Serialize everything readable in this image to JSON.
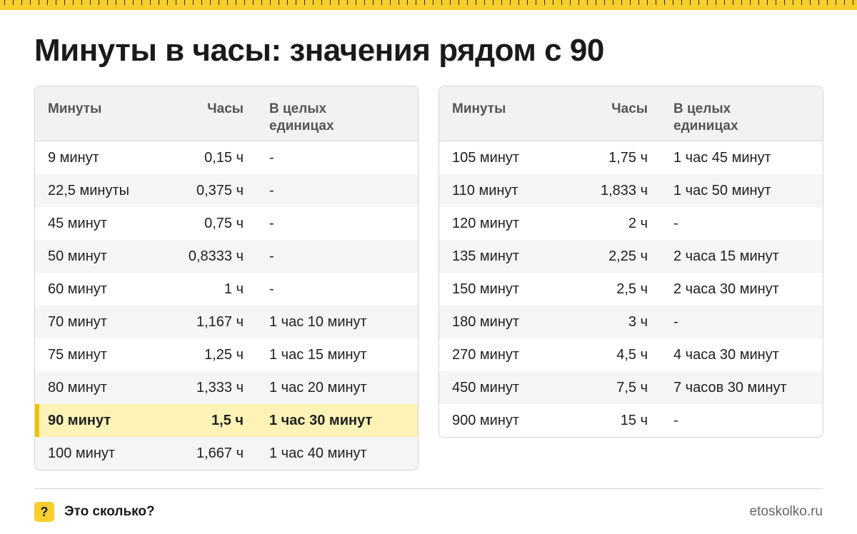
{
  "title": "Минуты в часы: значения рядом с 90",
  "headers": {
    "minutes": "Минуты",
    "hours": "Часы",
    "whole": "В целых\nединицах"
  },
  "left_rows": [
    {
      "minutes": "9 минут",
      "hours": "0,15 ч",
      "whole": "-"
    },
    {
      "minutes": "22,5 минуты",
      "hours": "0,375 ч",
      "whole": "-"
    },
    {
      "minutes": "45 минут",
      "hours": "0,75 ч",
      "whole": "-"
    },
    {
      "minutes": "50 минут",
      "hours": "0,8333 ч",
      "whole": "-"
    },
    {
      "minutes": "60 минут",
      "hours": "1 ч",
      "whole": "-"
    },
    {
      "minutes": "70 минут",
      "hours": "1,167 ч",
      "whole": "1 час 10 минут"
    },
    {
      "minutes": "75 минут",
      "hours": "1,25 ч",
      "whole": "1 час 15 минут"
    },
    {
      "minutes": "80 минут",
      "hours": "1,333 ч",
      "whole": "1 час 20 минут"
    },
    {
      "minutes": "90 минут",
      "hours": "1,5 ч",
      "whole": "1 час 30 минут",
      "highlight": true
    },
    {
      "minutes": "100 минут",
      "hours": "1,667 ч",
      "whole": "1 час 40 минут"
    }
  ],
  "right_rows": [
    {
      "minutes": "105 минут",
      "hours": "1,75 ч",
      "whole": "1 час 45 минут"
    },
    {
      "minutes": "110 минут",
      "hours": "1,833 ч",
      "whole": "1 час 50 минут"
    },
    {
      "minutes": "120 минут",
      "hours": "2 ч",
      "whole": "-"
    },
    {
      "minutes": "135 минут",
      "hours": "2,25 ч",
      "whole": "2 часа 15 минут"
    },
    {
      "minutes": "150 минут",
      "hours": "2,5 ч",
      "whole": "2 часа 30 минут"
    },
    {
      "minutes": "180 минут",
      "hours": "3 ч",
      "whole": "-"
    },
    {
      "minutes": "270 минут",
      "hours": "4,5 ч",
      "whole": "4 часа 30 минут"
    },
    {
      "minutes": "450 минут",
      "hours": "7,5 ч",
      "whole": "7 часов 30 минут"
    },
    {
      "minutes": "900 минут",
      "hours": "15 ч",
      "whole": "-"
    }
  ],
  "footer": {
    "badge": "?",
    "brand": "Это сколько?",
    "site": "etoskolko.ru"
  },
  "colors": {
    "accent": "#f7cf2c",
    "highlight_row": "#fdf3b6",
    "highlight_bar": "#f2c200",
    "header_bg": "#f2f2f2"
  }
}
